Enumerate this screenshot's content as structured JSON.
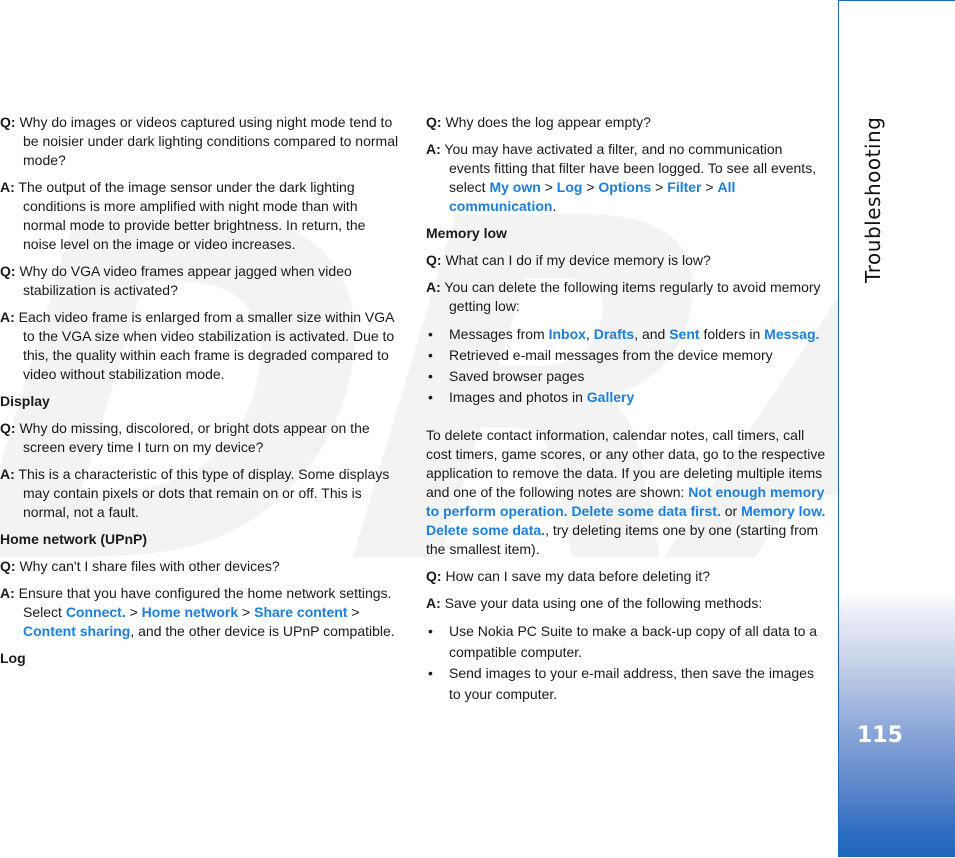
{
  "watermark": "DRAFT",
  "sidebar": {
    "section_title": "Troubleshooting",
    "page_number": "115"
  },
  "left_column": {
    "q1": {
      "q_label": "Q:",
      "q_text": "Why do images or videos captured using night mode tend to be noisier under dark lighting conditions compared to normal mode?",
      "a_label": "A:",
      "a_text": "The output of the image sensor under the dark lighting conditions is more amplified with night mode than with normal mode to provide better brightness. In return, the noise level on the image or video increases."
    },
    "q2": {
      "q_label": "Q:",
      "q_text": "Why do VGA video frames appear jagged when video stabilization is activated?",
      "a_label": "A:",
      "a_text": "Each video frame is enlarged from a smaller size within VGA to the VGA size when video stabilization is activated. Due to this, the quality within each frame is degraded compared to video without stabilization mode."
    },
    "display_heading": "Display",
    "q3": {
      "q_label": "Q:",
      "q_text": "Why do missing, discolored, or bright dots appear on the screen every time I turn on my device?",
      "a_label": "A:",
      "a_text": "This is a characteristic of this type of display. Some displays may contain pixels or dots that remain on or off. This is normal, not a fault."
    },
    "home_network_heading": "Home network (UPnP)",
    "q4": {
      "q_label": "Q:",
      "q_text": "Why can't I share files with other devices?",
      "a_label": "A:",
      "a_pre": "Ensure that you have configured the home network settings. Select ",
      "link1": "Connect.",
      "sep1": " > ",
      "link2": "Home network",
      "sep2": " > ",
      "link3": "Share content",
      "sep3": " > ",
      "link4": "Content sharing",
      "a_post": ", and the other device is UPnP compatible."
    },
    "log_heading": "Log"
  },
  "right_column": {
    "q5": {
      "q_label": "Q:",
      "q_text": "Why does the log appear empty?",
      "a_label": "A:",
      "a_pre": "You may have activated a filter, and no communication events fitting that filter have been logged. To see all events, select ",
      "link1": "My own",
      "sep1": " > ",
      "link2": "Log",
      "sep2": " > ",
      "link3": "Options",
      "sep3": " > ",
      "link4": "Filter",
      "sep4": " > ",
      "link5": "All communication",
      "a_post": "."
    },
    "memory_heading": "Memory low",
    "q6": {
      "q_label": "Q:",
      "q_text": "What can I do if my device memory is low?",
      "a_label": "A:",
      "a_text": "You can delete the following items regularly to avoid memory getting low:"
    },
    "memory_items": {
      "item1": {
        "pre": "Messages from ",
        "link1": "Inbox",
        "sep1": ", ",
        "link2": "Drafts",
        "sep2": ", and ",
        "link3": "Sent",
        "mid": " folders in ",
        "link4": "Messag."
      },
      "item2": "Retrieved e-mail messages from the device memory",
      "item3": "Saved browser pages",
      "item4": {
        "pre": "Images and photos in ",
        "link1": "Gallery"
      }
    },
    "delete_para": {
      "pre": "To delete contact information, calendar notes, call timers, call cost timers, game scores, or any other data, go to the respective application to remove the data. If you are deleting multiple items and one of the following notes are shown: ",
      "link1": "Not enough memory to perform operation. Delete some data first.",
      "mid": " or ",
      "link2": "Memory low. Delete some data.",
      "post": ", try deleting items one by one (starting from the smallest item)."
    },
    "q7": {
      "q_label": "Q:",
      "q_text": "How can I save my data before deleting it?",
      "a_label": "A:",
      "a_text": "Save your data using one of the following methods:"
    },
    "save_items": [
      "Use Nokia PC Suite to make a back-up copy of all data to a compatible computer.",
      "Send images to your e-mail address, then save the images to your computer."
    ]
  },
  "colors": {
    "link": "#1a7fe0",
    "sidebar_border": "#1f67b8",
    "sidebar_gradient_end": "#1f67b8",
    "watermark": "#f3f3f3"
  }
}
